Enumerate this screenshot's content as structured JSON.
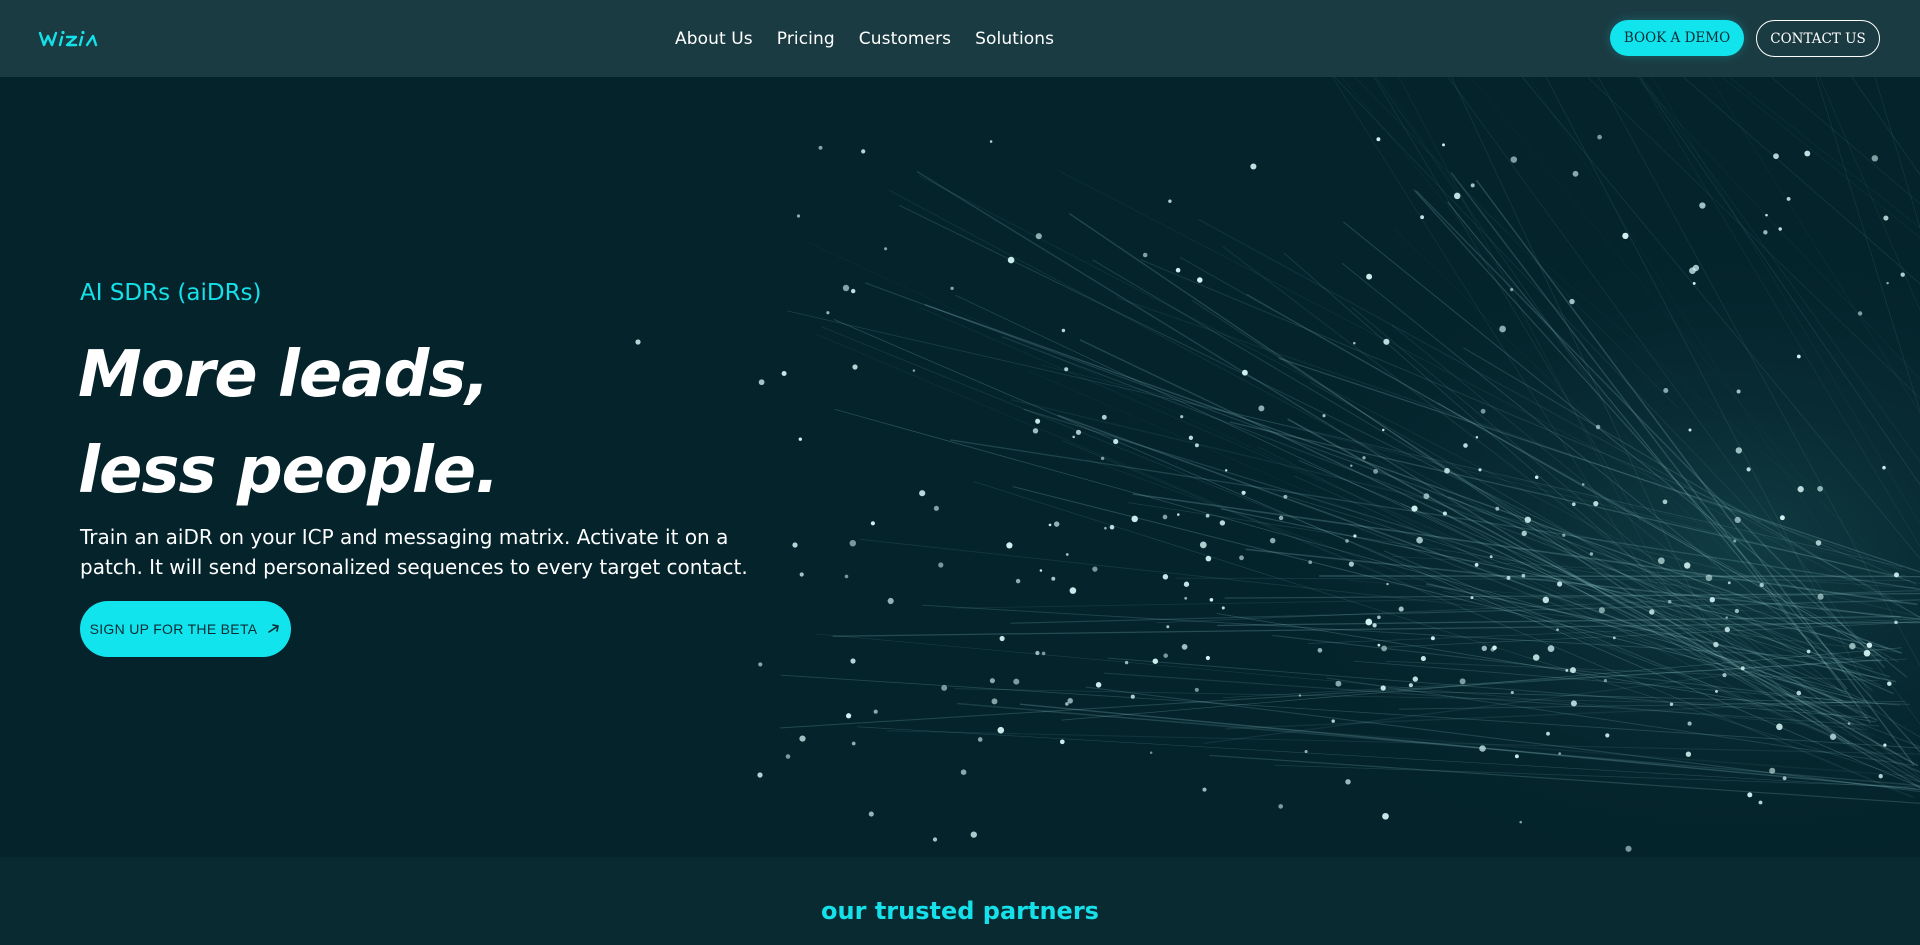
{
  "brand": {
    "logo_text": "WiZiA",
    "accent": "#12e4ee",
    "header_bg": "#1b3b42",
    "hero_bg": "#04232b"
  },
  "nav": {
    "items": [
      {
        "label": "About Us"
      },
      {
        "label": "Pricing"
      },
      {
        "label": "Customers"
      },
      {
        "label": "Solutions"
      }
    ]
  },
  "header_actions": {
    "book_demo": "BOOK A DEMO",
    "contact": "CONTACT US"
  },
  "hero": {
    "eyebrow": "AI SDRs (aiDRs)",
    "headline_line1": "More leads,",
    "headline_line2": "less people.",
    "subtext": "Train an aiDR on your ICP and messaging matrix. Activate it on a patch. It will send personalized sequences to every target contact.",
    "cta_label": "SIGN UP FOR THE BETA",
    "cta_icon": "arrow-up-right-icon",
    "background": "particle-network"
  },
  "partners": {
    "title": "our trusted partners"
  }
}
